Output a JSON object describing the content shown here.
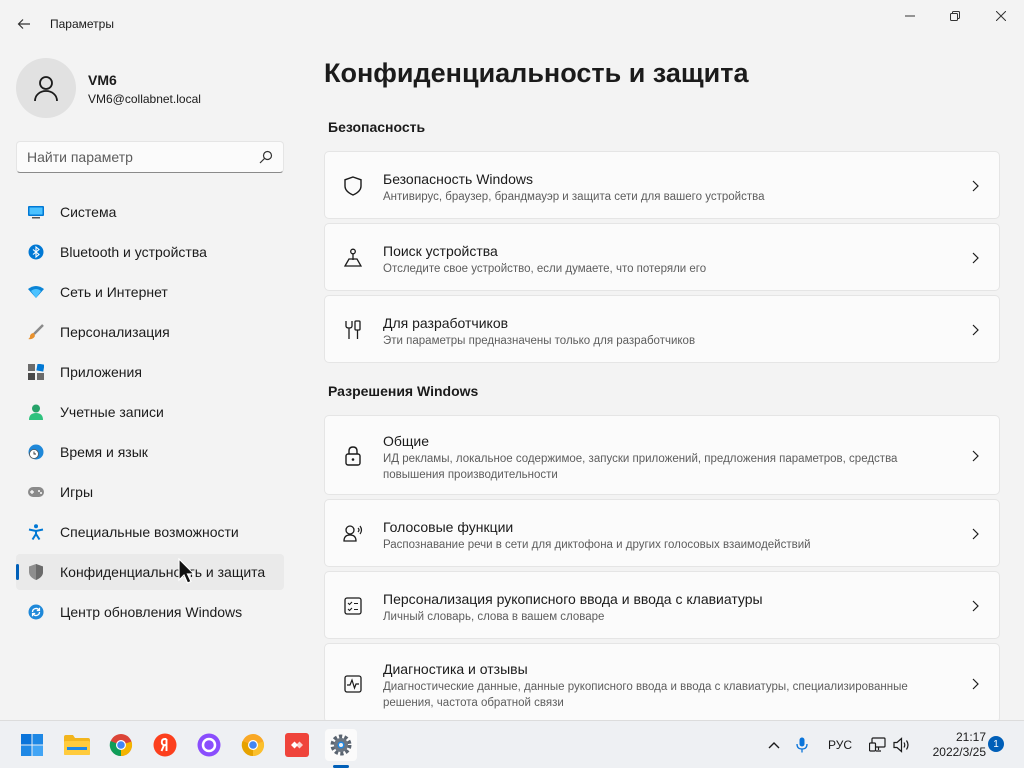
{
  "window": {
    "app_title": "Параметры"
  },
  "user": {
    "name": "VM6",
    "email": "VM6@collabnet.local"
  },
  "search": {
    "placeholder": "Найти параметр"
  },
  "sidebar": {
    "items": [
      {
        "label": "Система",
        "icon": "system-icon",
        "active": false
      },
      {
        "label": "Bluetooth и устройства",
        "icon": "bluetooth-icon",
        "active": false
      },
      {
        "label": "Сеть и Интернет",
        "icon": "network-icon",
        "active": false
      },
      {
        "label": "Персонализация",
        "icon": "brush-icon",
        "active": false
      },
      {
        "label": "Приложения",
        "icon": "apps-icon",
        "active": false
      },
      {
        "label": "Учетные записи",
        "icon": "account-icon",
        "active": false
      },
      {
        "label": "Время и язык",
        "icon": "time-language-icon",
        "active": false
      },
      {
        "label": "Игры",
        "icon": "gamepad-icon",
        "active": false
      },
      {
        "label": "Специальные возможности",
        "icon": "accessibility-icon",
        "active": false
      },
      {
        "label": "Конфиденциальность и защита",
        "icon": "shield-icon",
        "active": true
      },
      {
        "label": "Центр обновления Windows",
        "icon": "update-icon",
        "active": false
      }
    ]
  },
  "main": {
    "title": "Конфиденциальность и защита",
    "sections": [
      {
        "header": "Безопасность",
        "cards": [
          {
            "title": "Безопасность Windows",
            "desc": "Антивирус, браузер, брандмауэр и защита сети для вашего устройства",
            "icon": "shield-icon"
          },
          {
            "title": "Поиск устройства",
            "desc": "Отследите свое устройство, если думаете, что потеряли его",
            "icon": "find-device-icon"
          },
          {
            "title": "Для разработчиков",
            "desc": "Эти параметры предназначены только для разработчиков",
            "icon": "developer-tools-icon"
          }
        ]
      },
      {
        "header": "Разрешения Windows",
        "cards": [
          {
            "title": "Общие",
            "desc": "ИД рекламы, локальное содержимое, запуски приложений, предложения параметров, средства повышения производительности",
            "icon": "lock-icon"
          },
          {
            "title": "Голосовые функции",
            "desc": "Распознавание речи в сети для диктофона и других голосовых взаимодействий",
            "icon": "speech-icon"
          },
          {
            "title": "Персонализация рукописного ввода и ввода с клавиатуры",
            "desc": "Личный словарь, слова в вашем словаре",
            "icon": "checklist-icon"
          },
          {
            "title": "Диагностика и отзывы",
            "desc": "Диагностические данные, данные рукописного ввода и ввода с клавиатуры, специализированные решения, частота обратной связи",
            "icon": "diagnostics-icon"
          }
        ]
      }
    ]
  },
  "taskbar": {
    "apps": [
      "start-icon",
      "file-explorer-icon",
      "chrome-icon",
      "yandex-browser-icon",
      "alice-icon",
      "chrome-canary-icon",
      "anydesk-icon",
      "settings-icon"
    ],
    "language": "РУС",
    "time": "21:17",
    "date": "2022/3/25",
    "notification_count": "1"
  },
  "colors": {
    "accent": "#005fb8",
    "background": "#f3f3f3",
    "card": "#fbfbfb"
  }
}
